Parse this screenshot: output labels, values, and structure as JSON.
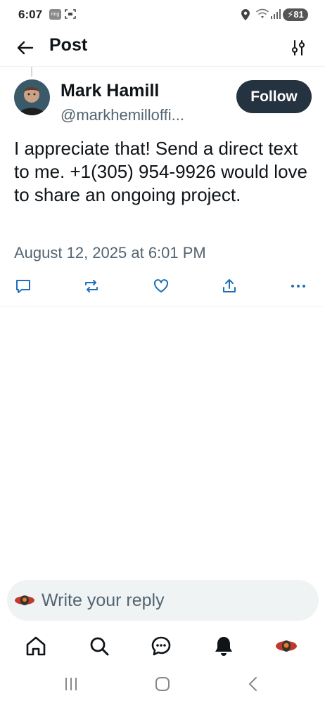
{
  "status_bar": {
    "time": "6:07",
    "app_badge": "ring",
    "battery": "81"
  },
  "header": {
    "title": "Post",
    "back_icon": "arrow-left-icon",
    "filter_icon": "sliders-icon"
  },
  "post": {
    "author_name": "Mark Hamill",
    "author_handle": "@markhemilloffi...",
    "follow_label": "Follow",
    "text": "I appreciate that! Send a direct text to me. +1(305) 954-9926 would love to share an ongoing project.",
    "timestamp": "August 12, 2025 at 6:01 PM",
    "actions": [
      "reply-icon",
      "repost-icon",
      "like-icon",
      "share-icon",
      "more-icon"
    ]
  },
  "reply": {
    "placeholder": "Write your reply"
  },
  "bottom_nav": [
    "home-icon",
    "search-icon",
    "messages-icon",
    "notifications-icon",
    "profile-icon"
  ],
  "colors": {
    "primary_text": "#0f1419",
    "secondary_text": "#536471",
    "follow_bg": "#25323f",
    "accent": "#1d9bf0"
  }
}
